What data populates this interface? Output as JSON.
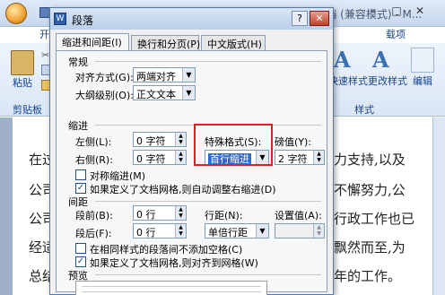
{
  "word": {
    "title": "新建 Microsoft Office Word 97 - 2003 文档 (兼容模式) - M...",
    "home_tab": "开",
    "tab_right": "载项",
    "paste": "粘贴",
    "clipboard": "剪贴板",
    "quick_styles": "快速样式",
    "change_styles": "更改样式",
    "edit": "编辑",
    "styles_group": "样式",
    "doc_left": [
      "在过",
      "公司",
      "公司的",
      "经适",
      "总结"
    ],
    "doc_right": [
      "力支持,以及",
      "不懈努力,公",
      "行政工作也已",
      "飘然而至,为",
      "年的工作。"
    ]
  },
  "dialog": {
    "title": "段落",
    "help": "?",
    "close": "✕",
    "tabs": [
      "缩进和间距(I)",
      "换行和分页(P)",
      "中文版式(H)"
    ],
    "general": {
      "title": "常规",
      "alignment_label": "对齐方式(G):",
      "alignment_value": "两端对齐",
      "outline_label": "大纲级别(O):",
      "outline_value": "正文文本"
    },
    "indent": {
      "title": "缩进",
      "left_label": "左侧(L):",
      "left_value": "0 字符",
      "right_label": "右侧(R):",
      "right_value": "0 字符",
      "special_label": "特殊格式(S):",
      "special_value": "首行缩进",
      "by_label": "磅值(Y):",
      "by_value": "2 字符",
      "mirror_label": "对称缩进(M)",
      "auto_adjust_label": "如果定义了文档网格,则自动调整右缩进(D)"
    },
    "spacing": {
      "title": "间距",
      "before_label": "段前(B):",
      "before_value": "0 行",
      "after_label": "段后(F):",
      "after_value": "0 行",
      "line_label": "行距(N):",
      "line_value": "单倍行距",
      "at_label": "设置值(A):",
      "no_space_label": "在相同样式的段落间不添加空格(C)",
      "snap_label": "如果定义了文档网格,则对齐到网格(W)"
    },
    "preview": {
      "title": "预览"
    }
  }
}
